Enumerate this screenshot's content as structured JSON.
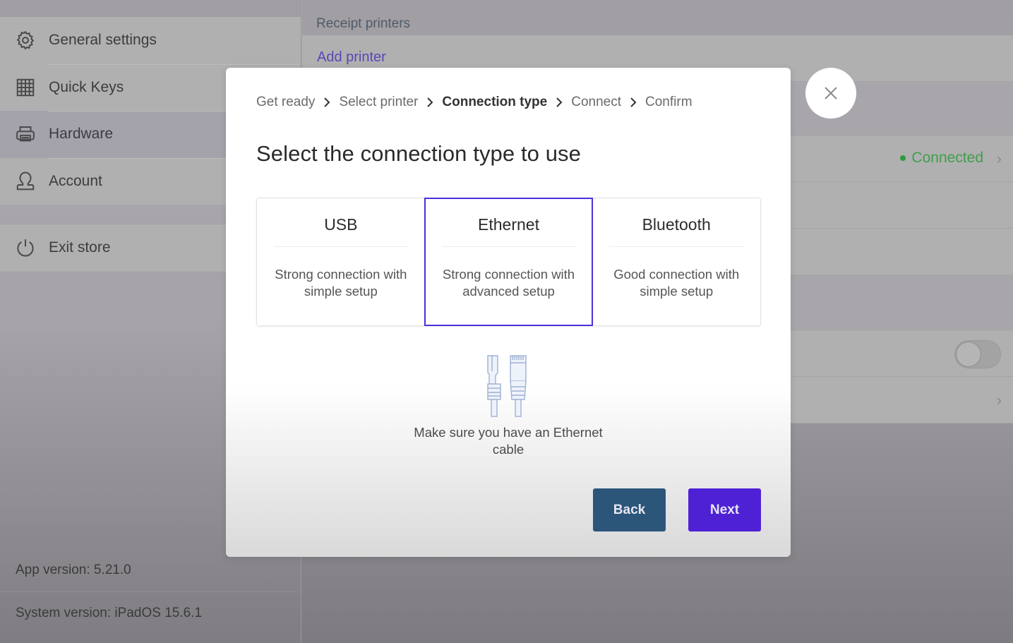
{
  "sidebar": {
    "items": [
      {
        "label": "General settings",
        "icon": "gear-icon"
      },
      {
        "label": "Quick Keys",
        "icon": "grid-icon"
      },
      {
        "label": "Hardware",
        "icon": "printer-icon",
        "active": true
      },
      {
        "label": "Account",
        "icon": "user-icon"
      }
    ],
    "exit": {
      "label": "Exit store",
      "icon": "power-icon"
    },
    "app_version": "App version: 5.21.0",
    "system_version": "System version: iPadOS 15.6.1"
  },
  "main": {
    "section_title": "Receipt printers",
    "add_printer_label": "Add printer",
    "printer_status": "Connected",
    "colors": {
      "connected": "#3f9e4c",
      "link": "#5a46b8"
    }
  },
  "modal": {
    "breadcrumb": [
      {
        "label": "Get ready",
        "current": false
      },
      {
        "label": "Select printer",
        "current": false
      },
      {
        "label": "Connection type",
        "current": true
      },
      {
        "label": "Connect",
        "current": false
      },
      {
        "label": "Confirm",
        "current": false
      }
    ],
    "title": "Select the connection type to use",
    "options": [
      {
        "title": "USB",
        "description": "Strong connection with simple setup",
        "selected": false
      },
      {
        "title": "Ethernet",
        "description": "Strong connection with advanced setup",
        "selected": true
      },
      {
        "title": "Bluetooth",
        "description": "Good connection with simple setup",
        "selected": false
      }
    ],
    "note": "Make sure you have an Ethernet cable",
    "back_label": "Back",
    "next_label": "Next",
    "colors": {
      "selected_border": "#4b30d9",
      "back": "#2c5679",
      "next": "#4e22d4"
    }
  }
}
